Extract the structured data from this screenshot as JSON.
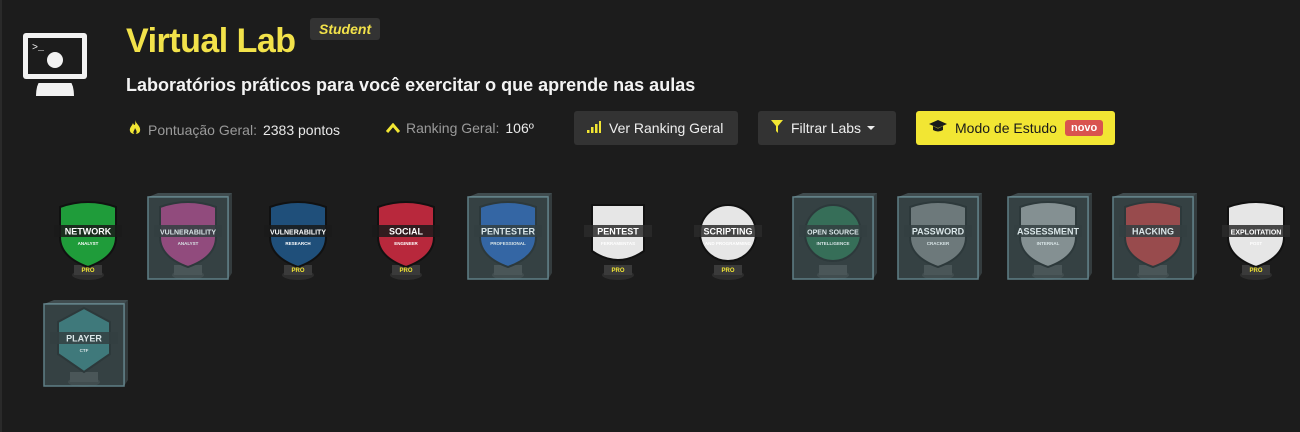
{
  "header": {
    "title": "Virtual Lab",
    "role_badge": "Student",
    "subtitle": "Laboratórios práticos para você exercitar o que aprende nas aulas",
    "icon": "monitor-terminal-icon"
  },
  "stats": {
    "score_label": "Pontuação Geral:",
    "score_value": "2383 pontos",
    "score_icon": "fire-icon",
    "ranking_label": "Ranking Geral:",
    "ranking_value": "106º",
    "ranking_icon": "chevron-up-icon"
  },
  "buttons": {
    "ranking": "Ver Ranking Geral",
    "filter": "Filtrar Labs",
    "study": "Modo de Estudo",
    "study_new": "novo"
  },
  "colors": {
    "accent_yellow": "#f2e633",
    "title_yellow": "#f2e24a",
    "background": "#1c1c1c",
    "new_badge": "#d9534f"
  },
  "labs": [
    {
      "name": "NETWORK",
      "sub": "ANALYST",
      "pro": "PRO",
      "locked": false,
      "shape": "shield",
      "color": "#1f9c3a"
    },
    {
      "name": "VULNERABILITY",
      "sub": "ANALYST",
      "pro": "",
      "locked": true,
      "shape": "shield",
      "color": "#9c2a6d"
    },
    {
      "name": "VULNERABILITY",
      "sub": "RESEARCH",
      "pro": "PRO",
      "locked": false,
      "shape": "shield",
      "color": "#1f4f7a"
    },
    {
      "name": "SOCIAL",
      "sub": "ENGINEER",
      "pro": "PRO",
      "locked": false,
      "shape": "shield",
      "color": "#b8283c"
    },
    {
      "name": "PENTESTER",
      "sub": "PROFESSIONAL",
      "pro": "",
      "locked": true,
      "shape": "shield",
      "color": "#1b4fa3"
    },
    {
      "name": "PENTEST",
      "sub": "FERRAMENTAS",
      "pro": "PRO",
      "locked": false,
      "shape": "doc",
      "color": "#e6e6e6"
    },
    {
      "name": "SCRIPTING",
      "sub": "AND PROGRAMMING",
      "pro": "PRO",
      "locked": false,
      "shape": "circle",
      "color": "#e6e6e6"
    },
    {
      "name": "OPEN SOURCE",
      "sub": "INTELLIGENCE",
      "pro": "",
      "locked": true,
      "shape": "circle",
      "color": "#1e5a3a"
    },
    {
      "name": "PASSWORD",
      "sub": "CRACKER",
      "pro": "",
      "locked": true,
      "shape": "shield",
      "color": "#6a6a6a"
    },
    {
      "name": "ASSESSMENT",
      "sub": "INTERNAL",
      "pro": "",
      "locked": true,
      "shape": "shield",
      "color": "#8a8a8a"
    },
    {
      "name": "HACKING",
      "sub": "",
      "pro": "",
      "locked": true,
      "shape": "shield",
      "color": "#a52a2a"
    },
    {
      "name": "EXPLOITATION",
      "sub": "POST",
      "pro": "PRO",
      "locked": false,
      "shape": "shield",
      "color": "#e6e6e6"
    },
    {
      "name": "PLAYER",
      "sub": "CTF",
      "pro": "",
      "locked": true,
      "shape": "hex",
      "color": "#2a6a6a"
    }
  ]
}
